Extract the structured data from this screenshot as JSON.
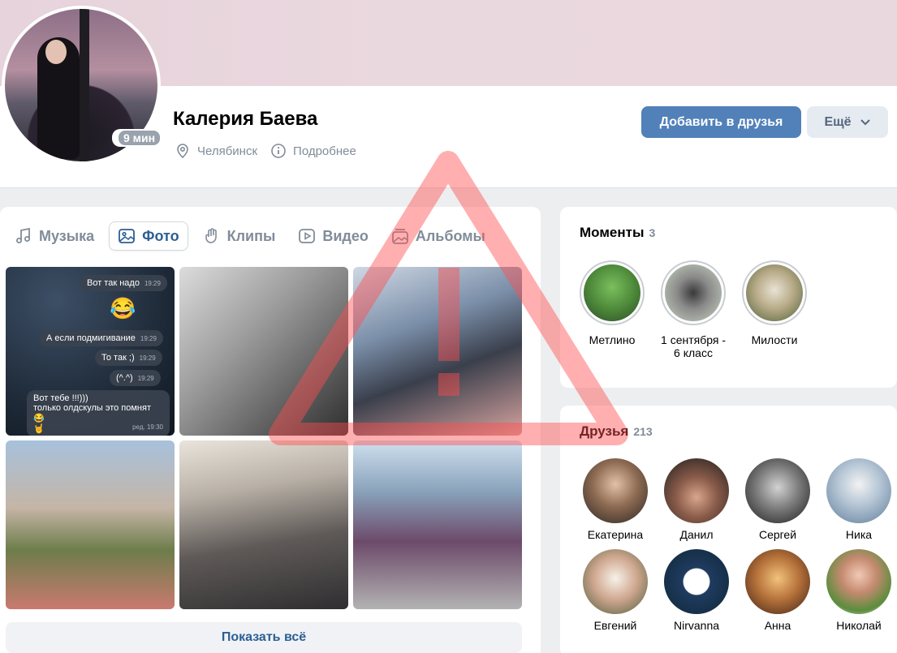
{
  "profile": {
    "name": "Калерия Баева",
    "online_badge": "9 мин",
    "city": "Челябинск",
    "details_link": "Подробнее",
    "add_friend_label": "Добавить в друзья",
    "more_label": "Ещё"
  },
  "media": {
    "tabs": [
      {
        "label": "Музыка",
        "icon": "music-icon",
        "active": false
      },
      {
        "label": "Фото",
        "icon": "photo-icon",
        "active": true
      },
      {
        "label": "Клипы",
        "icon": "clips-icon",
        "active": false
      },
      {
        "label": "Видео",
        "icon": "video-icon",
        "active": false
      },
      {
        "label": "Альбомы",
        "icon": "albums-icon",
        "active": false
      }
    ],
    "chat_photo": {
      "messages": [
        {
          "text": "Вот так надо",
          "time": "19:29"
        },
        {
          "text": "А если подмигивание",
          "time": "19:29"
        },
        {
          "text": "То так ;)",
          "time": "19:29"
        },
        {
          "text": "(^.^)",
          "time": "19:29"
        },
        {
          "text": "Вот тебе !!!)))",
          "time": ""
        },
        {
          "text": "только олдскулы это помнят 😂",
          "time": ""
        },
        {
          "text": "🤘",
          "time": "ред. 19:30"
        }
      ],
      "emoji": "😂"
    },
    "show_all_label": "Показать всё"
  },
  "moments": {
    "title": "Моменты",
    "count": "3",
    "items": [
      {
        "label": "Метлино"
      },
      {
        "label": "1 сентября - 6 класс"
      },
      {
        "label": "Милости"
      }
    ]
  },
  "friends": {
    "title": "Друзья",
    "count": "213",
    "items": [
      {
        "name": "Екатерина"
      },
      {
        "name": "Данил"
      },
      {
        "name": "Сергей"
      },
      {
        "name": "Ника"
      },
      {
        "name": "Евгений"
      },
      {
        "name": "Nirvanna"
      },
      {
        "name": "Анна"
      },
      {
        "name": "Николай"
      }
    ]
  },
  "colors": {
    "accent": "#5181b8",
    "link": "#2c5f93",
    "secondary_text": "#818c99",
    "watermark_red": "#ff4d4d"
  }
}
